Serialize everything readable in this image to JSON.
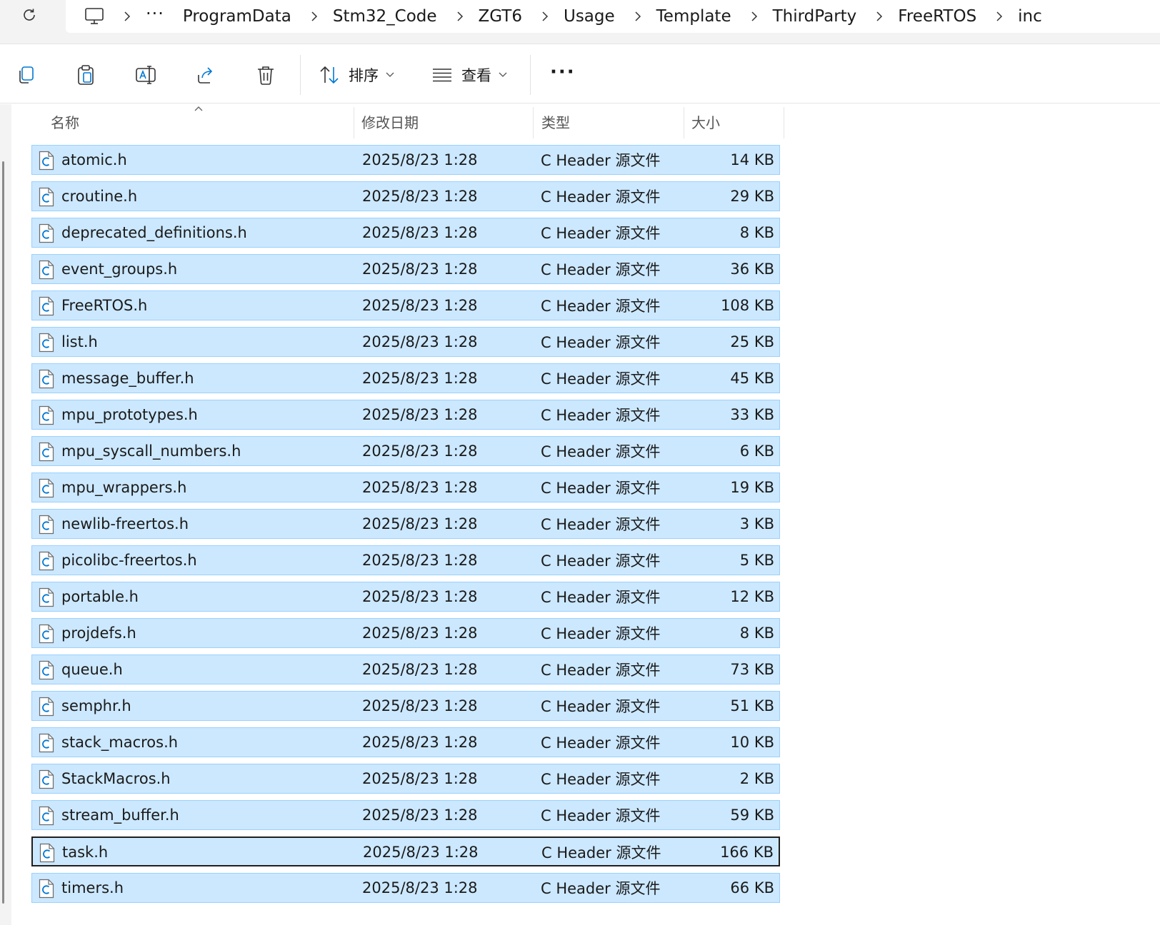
{
  "address_bar": {
    "more": "···",
    "breadcrumbs": [
      "ProgramData",
      "Stm32_Code",
      "ZGT6",
      "Usage",
      "Template",
      "ThirdParty",
      "FreeRTOS",
      "inc"
    ]
  },
  "toolbar": {
    "sort_label": "排序",
    "view_label": "查看",
    "more_label": "···"
  },
  "columns": {
    "name": "名称",
    "date": "修改日期",
    "type": "类型",
    "size": "大小"
  },
  "files": [
    {
      "name": "atomic.h",
      "date": "2025/8/23 1:28",
      "type": "C Header 源文件",
      "size": "14 KB"
    },
    {
      "name": "croutine.h",
      "date": "2025/8/23 1:28",
      "type": "C Header 源文件",
      "size": "29 KB"
    },
    {
      "name": "deprecated_definitions.h",
      "date": "2025/8/23 1:28",
      "type": "C Header 源文件",
      "size": "8 KB"
    },
    {
      "name": "event_groups.h",
      "date": "2025/8/23 1:28",
      "type": "C Header 源文件",
      "size": "36 KB"
    },
    {
      "name": "FreeRTOS.h",
      "date": "2025/8/23 1:28",
      "type": "C Header 源文件",
      "size": "108 KB"
    },
    {
      "name": "list.h",
      "date": "2025/8/23 1:28",
      "type": "C Header 源文件",
      "size": "25 KB"
    },
    {
      "name": "message_buffer.h",
      "date": "2025/8/23 1:28",
      "type": "C Header 源文件",
      "size": "45 KB"
    },
    {
      "name": "mpu_prototypes.h",
      "date": "2025/8/23 1:28",
      "type": "C Header 源文件",
      "size": "33 KB"
    },
    {
      "name": "mpu_syscall_numbers.h",
      "date": "2025/8/23 1:28",
      "type": "C Header 源文件",
      "size": "6 KB"
    },
    {
      "name": "mpu_wrappers.h",
      "date": "2025/8/23 1:28",
      "type": "C Header 源文件",
      "size": "19 KB"
    },
    {
      "name": "newlib-freertos.h",
      "date": "2025/8/23 1:28",
      "type": "C Header 源文件",
      "size": "3 KB"
    },
    {
      "name": "picolibc-freertos.h",
      "date": "2025/8/23 1:28",
      "type": "C Header 源文件",
      "size": "5 KB"
    },
    {
      "name": "portable.h",
      "date": "2025/8/23 1:28",
      "type": "C Header 源文件",
      "size": "12 KB"
    },
    {
      "name": "projdefs.h",
      "date": "2025/8/23 1:28",
      "type": "C Header 源文件",
      "size": "8 KB"
    },
    {
      "name": "queue.h",
      "date": "2025/8/23 1:28",
      "type": "C Header 源文件",
      "size": "73 KB"
    },
    {
      "name": "semphr.h",
      "date": "2025/8/23 1:28",
      "type": "C Header 源文件",
      "size": "51 KB"
    },
    {
      "name": "stack_macros.h",
      "date": "2025/8/23 1:28",
      "type": "C Header 源文件",
      "size": "10 KB"
    },
    {
      "name": "StackMacros.h",
      "date": "2025/8/23 1:28",
      "type": "C Header 源文件",
      "size": "2 KB"
    },
    {
      "name": "stream_buffer.h",
      "date": "2025/8/23 1:28",
      "type": "C Header 源文件",
      "size": "59 KB"
    },
    {
      "name": "task.h",
      "date": "2025/8/23 1:28",
      "type": "C Header 源文件",
      "size": "166 KB",
      "focused": true
    },
    {
      "name": "timers.h",
      "date": "2025/8/23 1:28",
      "type": "C Header 源文件",
      "size": "66 KB"
    }
  ],
  "colors": {
    "selection_fill": "#cce8ff",
    "selection_border": "#99d1ff",
    "focus_border": "#1f1f1f",
    "icon_accent": "#0078d4"
  }
}
